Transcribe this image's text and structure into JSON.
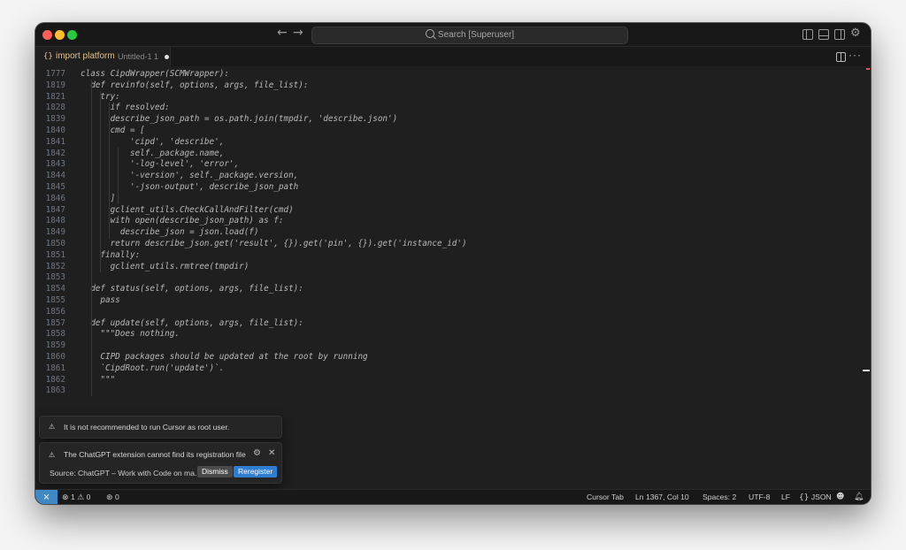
{
  "titlebar": {
    "search_text": "Search [Superuser]"
  },
  "tab": {
    "name": "import platform",
    "subtitle": "Untitled-1 1",
    "icon": "{}"
  },
  "editor": {
    "lines": [
      {
        "n": "1777",
        "code": "class CipdWrapper(SCMWrapper):"
      },
      {
        "n": "1819",
        "code": "  def revinfo(self, options, args, file_list):"
      },
      {
        "n": "1821",
        "code": "    try:"
      },
      {
        "n": "1828",
        "code": "      if resolved:"
      },
      {
        "n": "1839",
        "code": "      describe_json_path = os.path.join(tmpdir, 'describe.json')"
      },
      {
        "n": "1840",
        "code": "      cmd = ["
      },
      {
        "n": "1841",
        "code": "          'cipd', 'describe',"
      },
      {
        "n": "1842",
        "code": "          self._package.name,"
      },
      {
        "n": "1843",
        "code": "          '-log-level', 'error',"
      },
      {
        "n": "1844",
        "code": "          '-version', self._package.version,"
      },
      {
        "n": "1845",
        "code": "          '-json-output', describe_json_path"
      },
      {
        "n": "1846",
        "code": "      ]"
      },
      {
        "n": "1847",
        "code": "      gclient_utils.CheckCallAndFilter(cmd)"
      },
      {
        "n": "1848",
        "code": "      with open(describe_json_path) as f:"
      },
      {
        "n": "1849",
        "code": "        describe_json = json.load(f)"
      },
      {
        "n": "1850",
        "code": "      return describe_json.get('result', {}).get('pin', {}).get('instance_id')"
      },
      {
        "n": "1851",
        "code": "    finally:"
      },
      {
        "n": "1852",
        "code": "      gclient_utils.rmtree(tmpdir)"
      },
      {
        "n": "1853",
        "code": ""
      },
      {
        "n": "1854",
        "code": "  def status(self, options, args, file_list):"
      },
      {
        "n": "1855",
        "code": "    pass"
      },
      {
        "n": "1856",
        "code": ""
      },
      {
        "n": "1857",
        "code": "  def update(self, options, args, file_list):"
      },
      {
        "n": "1858",
        "code": "    \"\"\"Does nothing."
      },
      {
        "n": "1859",
        "code": ""
      },
      {
        "n": "1860",
        "code": "    CIPD packages should be updated at the root by running"
      },
      {
        "n": "1861",
        "code": "    `CipdRoot.run('update')`."
      },
      {
        "n": "1862",
        "code": "    \"\"\""
      },
      {
        "n": "1863",
        "code": ""
      }
    ]
  },
  "notifications": {
    "root_warning": "It is not recommended to run Cursor as root user.",
    "chatgpt_message": "The ChatGPT extension cannot find its registration file",
    "chatgpt_source": "Source: ChatGPT – Work with Code on ma...",
    "dismiss_label": "Dismiss",
    "reregister_label": "Reregister"
  },
  "statusbar": {
    "errors": "1",
    "warnings": "0",
    "ports": "0",
    "cursor_tab": "Cursor Tab",
    "position": "Ln 1367, Col 10",
    "spaces": "Spaces: 2",
    "encoding": "UTF-8",
    "eol": "LF",
    "language": "JSON"
  }
}
